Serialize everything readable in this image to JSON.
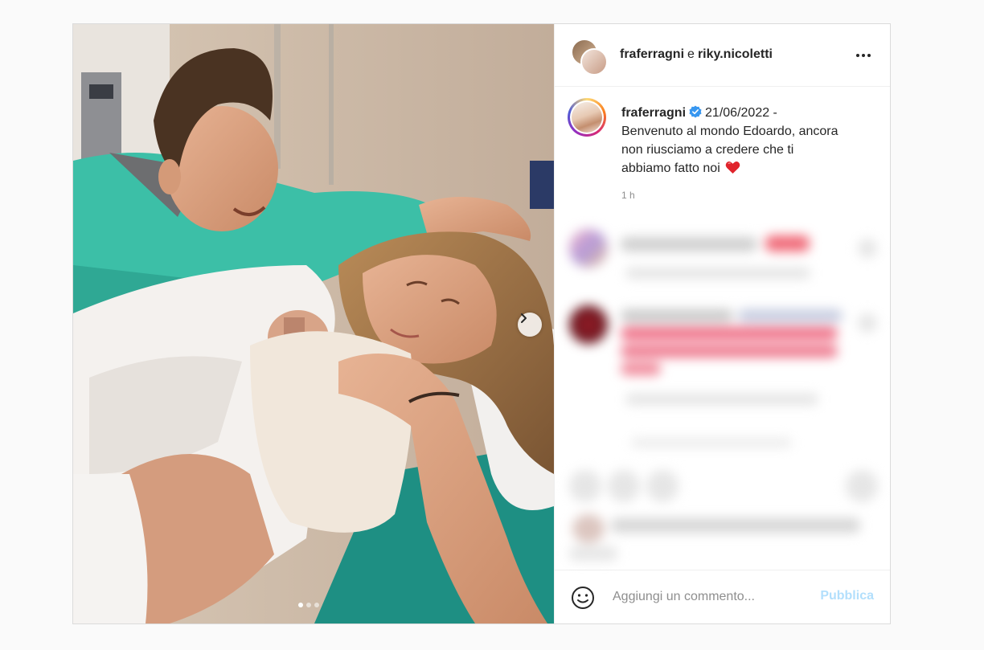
{
  "header": {
    "user1": "fraferragni",
    "separator": "e",
    "user2": "riky.nicoletti",
    "more_icon": "more-horizontal-icon"
  },
  "caption": {
    "username": "fraferragni",
    "verified_icon": "verified-badge-icon",
    "text_line1": "21/06/2022 -",
    "text_line2": "Benvenuto al mondo Edoardo, ancora",
    "text_line3": "non riusciamo a credere che ti",
    "text_line4": "abbiamo fatto noi",
    "emoji": "❤️",
    "timestamp": "1 h"
  },
  "media": {
    "next_icon": "chevron-right-icon",
    "carousel_count": 3,
    "carousel_active": 1
  },
  "comment_box": {
    "emoji_icon": "emoji-smile-icon",
    "placeholder": "Aggiungi un commento...",
    "publish_label": "Pubblica"
  },
  "colors": {
    "verified_blue": "#3897f0",
    "publish_disabled": "#b2dffc",
    "scrub_green": "#3cbfa7"
  }
}
